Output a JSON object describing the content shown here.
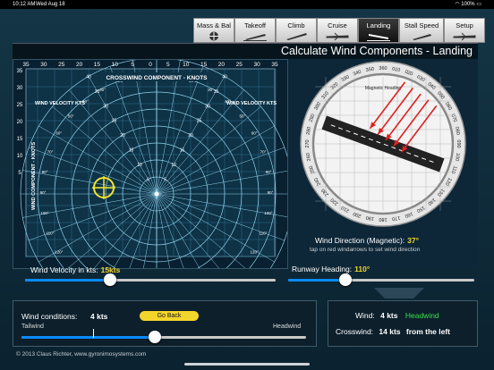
{
  "status": {
    "time": "10:12 AM",
    "date": "Wed Aug 18",
    "battery": "100%"
  },
  "tabs": [
    {
      "label": "Mass & Bal",
      "icon": "scale-icon"
    },
    {
      "label": "Takeoff",
      "icon": "plane-takeoff-icon"
    },
    {
      "label": "Climb",
      "icon": "plane-climb-icon"
    },
    {
      "label": "Cruise",
      "icon": "plane-cruise-icon"
    },
    {
      "label": "Landing",
      "icon": "plane-landing-icon"
    },
    {
      "label": "Stall Speed",
      "icon": "plane-stall-icon"
    },
    {
      "label": "Setup",
      "icon": "plane-setup-icon"
    }
  ],
  "title": "Calculate Wind Components - Landing",
  "chart": {
    "crosswind_title": "CROSSWIND COMPONENT - KNOTS",
    "velocity_label_left": "WIND VELOCITY KTS",
    "velocity_label_right": "WIND VELOCITY KTS",
    "wind_component_label": "WIND COMPONENT - KNOTS",
    "top_ticks": [
      "35",
      "30",
      "25",
      "20",
      "15",
      "10",
      "5",
      "0",
      "5",
      "10",
      "15",
      "20",
      "25",
      "30",
      "35"
    ],
    "left_ticks": [
      "35",
      "30",
      "25",
      "20",
      "15",
      "10",
      "5"
    ],
    "angle_labels": [
      "10°",
      "20°",
      "30°",
      "40°",
      "50°",
      "60°",
      "70°",
      "80°",
      "90°",
      "100°",
      "110°",
      "120°"
    ],
    "speed_labels": [
      "5",
      "10",
      "15",
      "20",
      "25",
      "30",
      "35",
      "40"
    ]
  },
  "compass": {
    "magnetic_label": "Magnetic Heading",
    "ticks": [
      "360",
      "010",
      "020",
      "030",
      "040",
      "050",
      "060",
      "070",
      "080",
      "090",
      "100",
      "110",
      "120",
      "130",
      "140",
      "150",
      "160",
      "170",
      "180",
      "190",
      "200",
      "210",
      "220",
      "230",
      "240",
      "250",
      "260",
      "270",
      "280",
      "290",
      "300",
      "310",
      "320",
      "330",
      "340",
      "350"
    ]
  },
  "wind_direction": {
    "label": "Wind Direction (Magnetic):",
    "value": "37°",
    "hint": "tap on red windarrows to set wind direction"
  },
  "velocity": {
    "label": "Wind Velocity in kts:",
    "value": "15kts",
    "fraction": 0.34
  },
  "runway": {
    "label": "Runway Heading:",
    "value": "110°",
    "fraction": 0.31
  },
  "conditions": {
    "label": "Wind conditions:",
    "value": "4",
    "unit": "kts",
    "tail": "Tailwind",
    "head": "Headwind",
    "go_back": "Go Back",
    "fraction": 0.47
  },
  "results": {
    "wind_label": "Wind:",
    "wind_value": "4 kts",
    "wind_type": "Headwind",
    "cross_label": "Crosswind:",
    "cross_value": "14 kts",
    "cross_side": "from the left"
  },
  "footer": "© 2013 Claus Richter, www.gyronimosystems.com",
  "colors": {
    "accent": "#f3d62b",
    "headwind": "#3ce04a",
    "slider": "#0a8aff",
    "arrow": "#e02020"
  }
}
